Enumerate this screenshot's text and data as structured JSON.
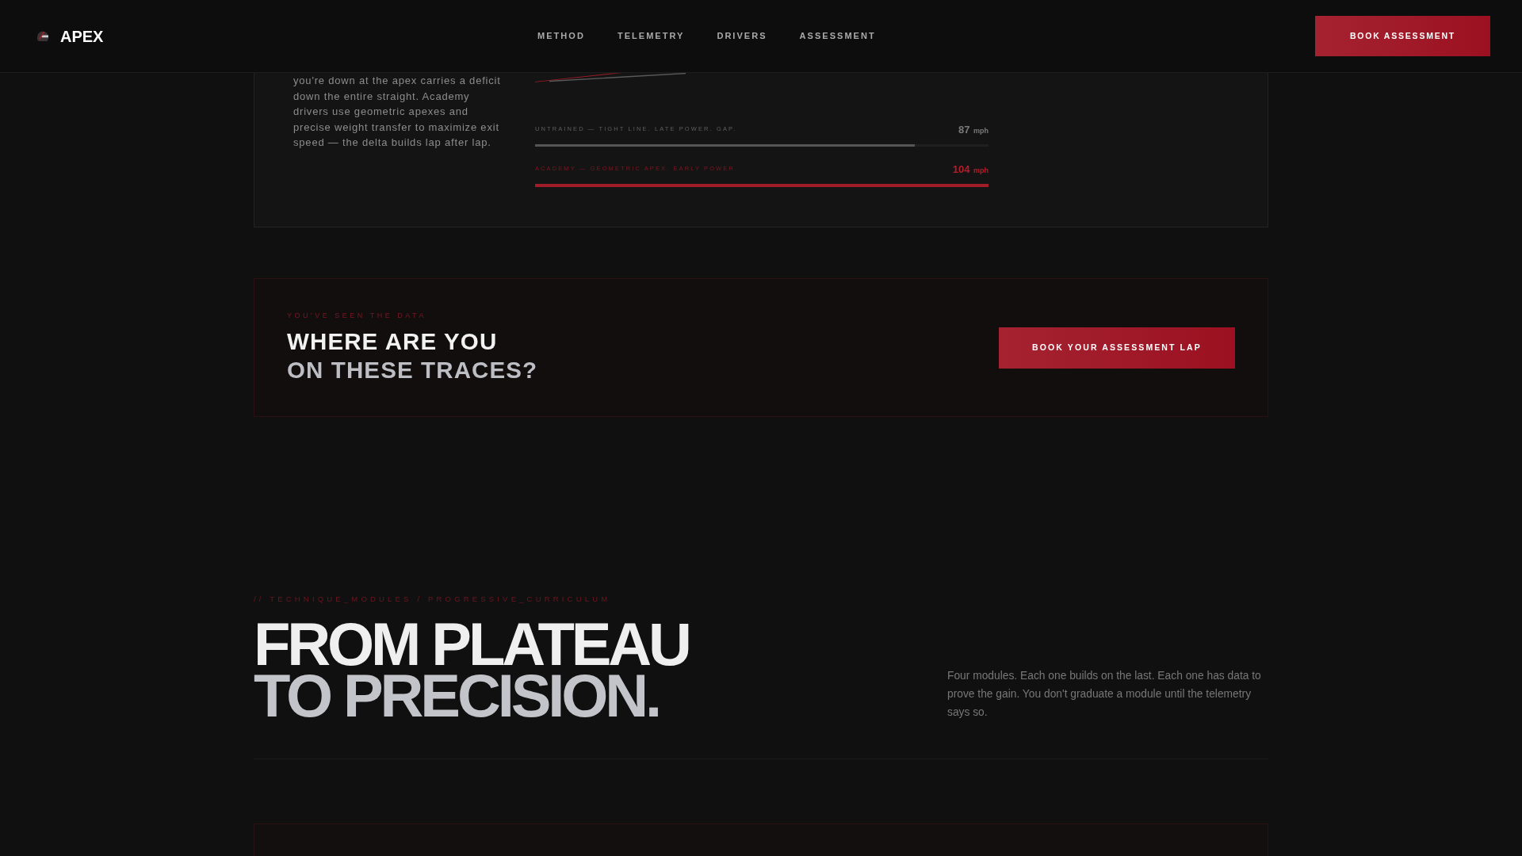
{
  "header": {
    "logo": {
      "text": "APEX"
    },
    "nav": [
      {
        "label": "METHOD"
      },
      {
        "label": "TELEMETRY"
      },
      {
        "label": "DRIVERS"
      },
      {
        "label": "ASSESSMENT"
      }
    ],
    "cta": "BOOK ASSESSMENT"
  },
  "comparison_card": {
    "description": "you're down at the apex carries a deficit down the entire straight. Academy drivers use geometric apexes and precise weight transfer to maximize exit speed — the delta builds lap after lap.",
    "bars": [
      {
        "kind": "untrained",
        "label": "UNTRAINED — TIGHT LINE. LATE POWER. GAP.",
        "value": "87",
        "unit": "mph",
        "level": 0.837
      },
      {
        "kind": "academy",
        "label": "ACADEMY — GEOMETRIC APEX. EARLY POWER.",
        "value": "104",
        "unit": "mph",
        "level": 1
      }
    ]
  },
  "cta_card": {
    "eyebrow": "YOU'VE SEEN THE DATA",
    "title_lines": [
      "WHERE ARE YOU",
      "ON THESE TRACES?"
    ],
    "button": "BOOK YOUR ASSESSMENT LAP"
  },
  "modules_section": {
    "eyebrow": "// TECHNIQUE_MODULES / PROGRESSIVE_CURRICULUM",
    "title_lines": [
      "FROM PLATEAU",
      "TO PRECISION."
    ],
    "intro": "Four modules. Each one builds on the last. Each one has data to prove the gain. You don't graduate a module until the telemetry says so."
  }
}
